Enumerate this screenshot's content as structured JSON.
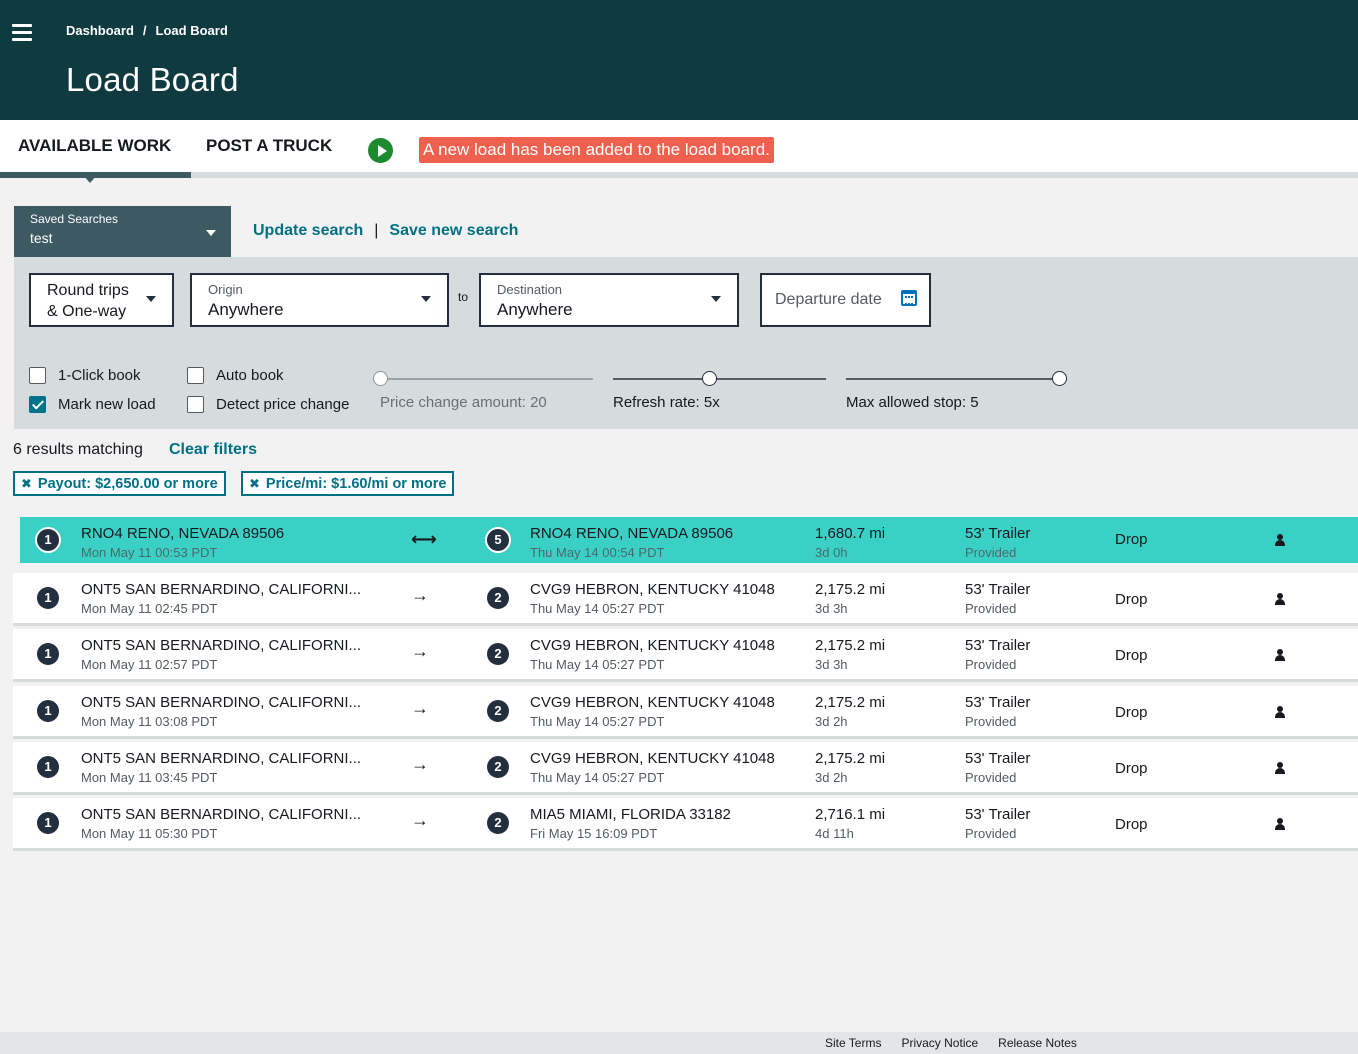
{
  "header": {
    "breadcrumb": [
      "Dashboard",
      "/",
      "Load Board"
    ],
    "title": "Load Board"
  },
  "tabs": [
    {
      "label": "AVAILABLE WORK",
      "active": true
    },
    {
      "label": "POST A TRUCK",
      "active": false
    }
  ],
  "alert": "A new load has been added to the load board.",
  "saved_search": {
    "label": "Saved Searches",
    "value": "test"
  },
  "search_links": {
    "update": "Update search",
    "separator": "|",
    "save": "Save new search"
  },
  "filters": {
    "trip_type": {
      "line1": "Round trips",
      "line2": "& One-way"
    },
    "origin": {
      "label": "Origin",
      "value": "Anywhere"
    },
    "to": "to",
    "destination": {
      "label": "Destination",
      "value": "Anywhere"
    },
    "departure": {
      "placeholder": "Departure date"
    },
    "checkboxes": [
      {
        "label": "1-Click book",
        "checked": false
      },
      {
        "label": "Mark new load",
        "checked": true
      },
      {
        "label": "Auto book",
        "checked": false
      },
      {
        "label": "Detect price change",
        "checked": false
      }
    ],
    "sliders": [
      {
        "label": "Price change amount: 20",
        "fraction": 0.0,
        "enabled": false
      },
      {
        "label": "Refresh rate: 5x",
        "fraction": 0.45,
        "enabled": true
      },
      {
        "label": "Max allowed stop: 5",
        "fraction": 1.0,
        "enabled": true
      }
    ]
  },
  "results": {
    "count_text": "6 results matching",
    "clear": "Clear filters"
  },
  "chips": [
    {
      "icon": "close-icon",
      "label": "Payout: $2,650.00 or more"
    },
    {
      "icon": "close-icon",
      "label": "Price/mi: $1.60/mi or more"
    }
  ],
  "loads": [
    {
      "origin_stop": "1",
      "origin": "RNO4 RENO, NEVADA 89506",
      "origin_time": "Mon May 11 00:53 PDT",
      "arrow": "⟷",
      "dest_stop": "5",
      "dest": "RNO4 RENO, NEVADA 89506",
      "dest_time": "Thu May 14 00:54 PDT",
      "distance": "1,680.7 mi",
      "duration": "3d 0h",
      "equipment": "53' Trailer",
      "equipment_sub": "Provided",
      "type": "Drop",
      "highlight": true
    },
    {
      "origin_stop": "1",
      "origin": "ONT5 SAN BERNARDINO, CALIFORNI...",
      "origin_time": "Mon May 11 02:45 PDT",
      "arrow": "→",
      "dest_stop": "2",
      "dest": "CVG9 HEBRON, KENTUCKY 41048",
      "dest_time": "Thu May 14 05:27 PDT",
      "distance": "2,175.2 mi",
      "duration": "3d 3h",
      "equipment": "53' Trailer",
      "equipment_sub": "Provided",
      "type": "Drop",
      "highlight": false
    },
    {
      "origin_stop": "1",
      "origin": "ONT5 SAN BERNARDINO, CALIFORNI...",
      "origin_time": "Mon May 11 02:57 PDT",
      "arrow": "→",
      "dest_stop": "2",
      "dest": "CVG9 HEBRON, KENTUCKY 41048",
      "dest_time": "Thu May 14 05:27 PDT",
      "distance": "2,175.2 mi",
      "duration": "3d 3h",
      "equipment": "53' Trailer",
      "equipment_sub": "Provided",
      "type": "Drop",
      "highlight": false
    },
    {
      "origin_stop": "1",
      "origin": "ONT5 SAN BERNARDINO, CALIFORNI...",
      "origin_time": "Mon May 11 03:08 PDT",
      "arrow": "→",
      "dest_stop": "2",
      "dest": "CVG9 HEBRON, KENTUCKY 41048",
      "dest_time": "Thu May 14 05:27 PDT",
      "distance": "2,175.2 mi",
      "duration": "3d 2h",
      "equipment": "53' Trailer",
      "equipment_sub": "Provided",
      "type": "Drop",
      "highlight": false
    },
    {
      "origin_stop": "1",
      "origin": "ONT5 SAN BERNARDINO, CALIFORNI...",
      "origin_time": "Mon May 11 03:45 PDT",
      "arrow": "→",
      "dest_stop": "2",
      "dest": "CVG9 HEBRON, KENTUCKY 41048",
      "dest_time": "Thu May 14 05:27 PDT",
      "distance": "2,175.2 mi",
      "duration": "3d 2h",
      "equipment": "53' Trailer",
      "equipment_sub": "Provided",
      "type": "Drop",
      "highlight": false
    },
    {
      "origin_stop": "1",
      "origin": "ONT5 SAN BERNARDINO, CALIFORNI...",
      "origin_time": "Mon May 11 05:30 PDT",
      "arrow": "→",
      "dest_stop": "2",
      "dest": "MIA5 MIAMI, FLORIDA 33182",
      "dest_time": "Fri May 15 16:09 PDT",
      "distance": "2,716.1 mi",
      "duration": "4d 11h",
      "equipment": "53' Trailer",
      "equipment_sub": "Provided",
      "type": "Drop",
      "highlight": false
    }
  ],
  "footer": [
    "Site Terms",
    "Privacy Notice",
    "Release Notes"
  ],
  "colors": {
    "header_bg": "#0e3a40",
    "accent": "#007185",
    "alert": "#f0604e",
    "highlight_row": "#3bd0c5",
    "play": "#1d8a2f"
  }
}
